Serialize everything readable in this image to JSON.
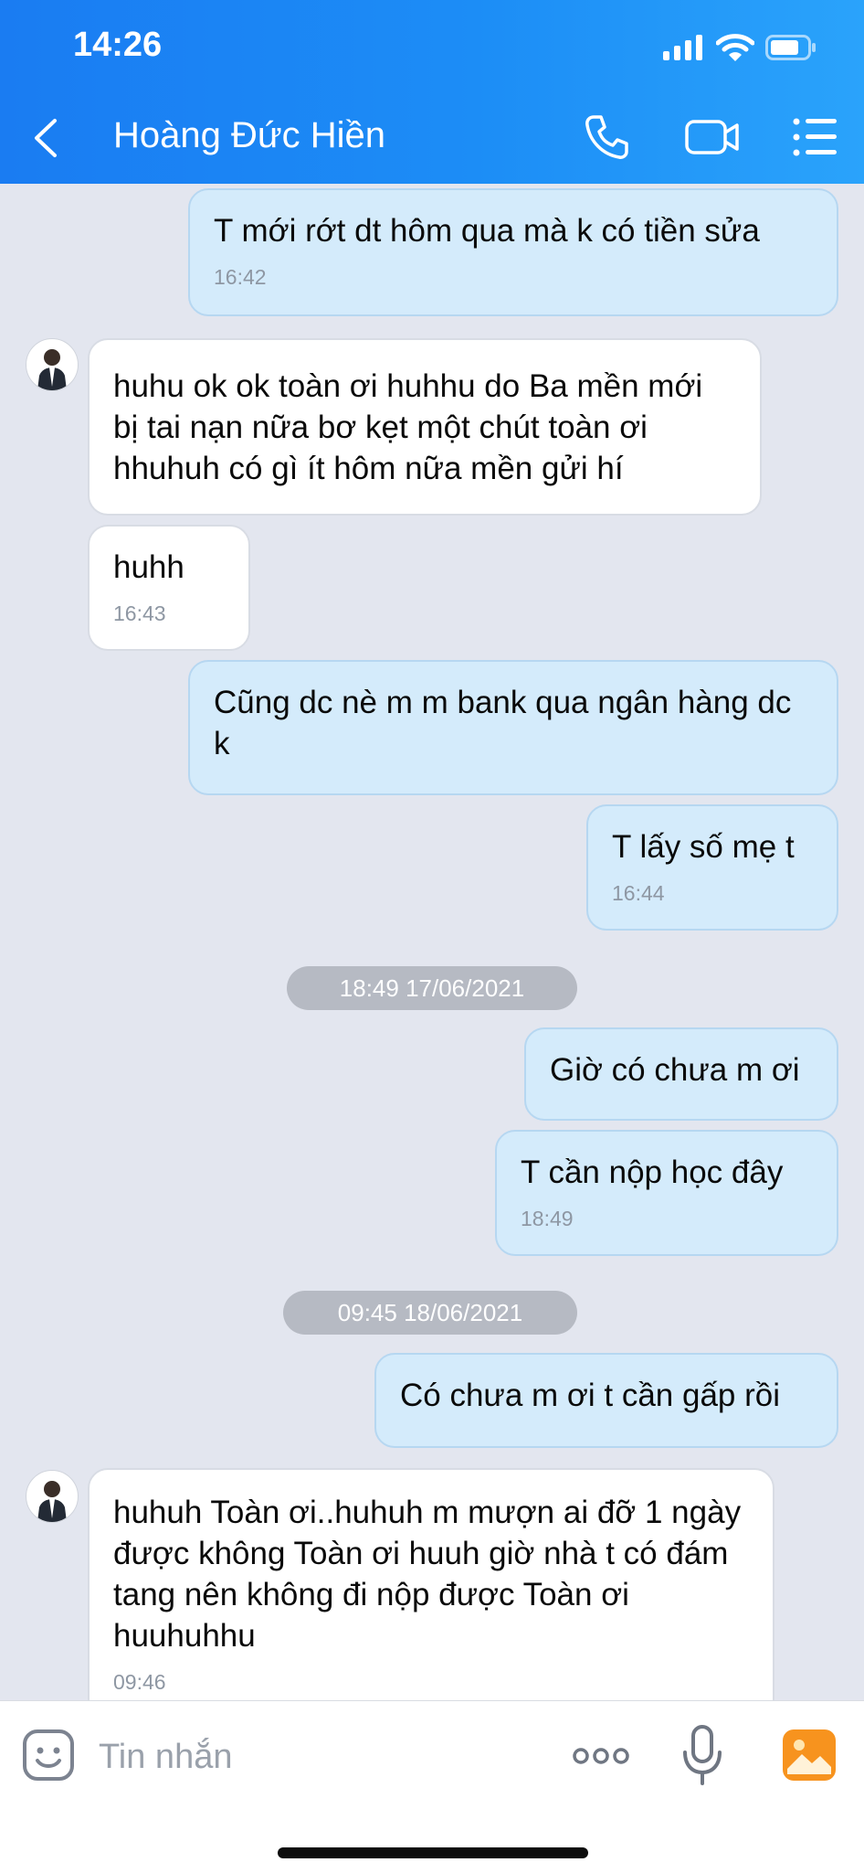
{
  "status_bar": {
    "time": "14:26"
  },
  "header": {
    "contact_name": "Hoàng Đức Hiền"
  },
  "messages": [
    {
      "text": "T mới rớt dt hôm qua mà k có tiền sửa",
      "time": "16:42"
    },
    {
      "text": "huhu ok ok toàn ơi huhhu do Ba mền mới bị tai nạn nữa bơ kẹt một chút toàn ơi hhuhuh có gì ít hôm nữa mền gửi hí"
    },
    {
      "text": "huhh",
      "time": "16:43"
    },
    {
      "text": "Cũng dc nè m m bank qua ngân hàng dc k"
    },
    {
      "text": "T lấy số mẹ t",
      "time": "16:44"
    },
    {
      "text": "Giờ có chưa m ơi"
    },
    {
      "text": "T cần nộp học đây",
      "time": "18:49"
    },
    {
      "text": "Có chưa m ơi t cần gấp rồi"
    },
    {
      "text": "huhuh Toàn ơi..huhuh m mượn ai đỡ 1 ngày được không Toàn ơi huuh giờ nhà t có đám tang nên không đi nộp được Toàn ơi huuhuhhu",
      "time": "09:46"
    }
  ],
  "date_separators": [
    "18:49 17/06/2021",
    "09:45 18/06/2021"
  ],
  "input_bar": {
    "placeholder": "Tin nhắn"
  },
  "colors": {
    "header": "#1c8df6",
    "outgoing_bubble": "#d4ebfb",
    "incoming_bubble": "#ffffff",
    "background": "#e3e6ef"
  }
}
